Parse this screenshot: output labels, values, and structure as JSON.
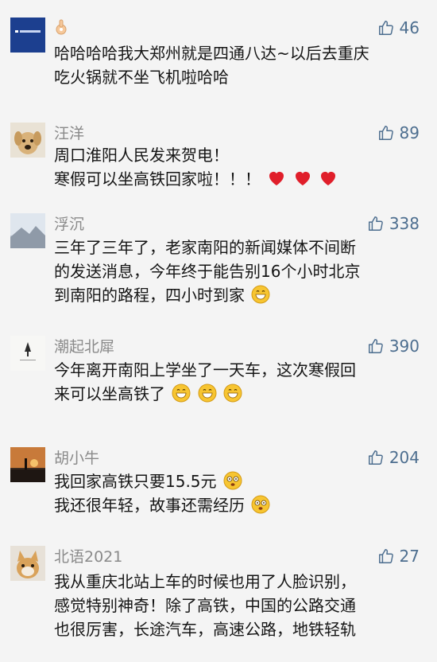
{
  "comments": [
    {
      "name": "",
      "avatar": "blue-logo-avatar",
      "name_icon": "ok-hand-icon",
      "likes": "46",
      "lines": [
        "哈哈哈哈我大郑州就是四通八达~以后去重庆",
        "吃火锅就不坐飞机啦哈哈"
      ]
    },
    {
      "name": "汪洋",
      "avatar": "dog-avatar",
      "likes": "89",
      "lines": [
        "周口淮阳人民发来贺电！",
        "寒假可以坐高铁回家啦！！！"
      ],
      "line_emojis": [
        [],
        [
          "red-heart-icon",
          "red-heart-icon",
          "red-heart-icon"
        ]
      ]
    },
    {
      "name": "浮沉",
      "avatar": "landscape-avatar",
      "likes": "338",
      "lines": [
        "三年了三年了，老家南阳的新闻媒体不间断",
        "的发送消息，今年终于能告别16个小时北京",
        "到南阳的路程，四小时到家"
      ],
      "line_emojis": [
        [],
        [],
        [
          "grin-emoji-icon"
        ]
      ]
    },
    {
      "name": "潮起北犀",
      "avatar": "ink-painting-avatar",
      "likes": "390",
      "lines": [
        "今年离开南阳上学坐了一天车，这次寒假回",
        "来可以坐高铁了"
      ],
      "line_emojis": [
        [],
        [
          "grin-emoji-icon",
          "grin-emoji-icon",
          "grin-emoji-icon"
        ]
      ]
    },
    {
      "name": "胡小牛",
      "avatar": "sunset-silhouette-avatar",
      "likes": "204",
      "lines": [
        "我回家高铁只要15.5元",
        "我还很年轻，故事还需经历"
      ],
      "line_emojis": [
        [
          "dizzy-face-icon"
        ],
        [
          "dizzy-face-icon"
        ]
      ]
    },
    {
      "name": "北语2021",
      "avatar": "cat-avatar",
      "likes": "27",
      "lines": [
        "我从重庆北站上车的时候也用了人脸识别，",
        "感觉特别神奇！除了高铁，中国的公路交通",
        "也很厉害，长途汽车，高速公路，地铁轻轨"
      ]
    }
  ],
  "colors": {
    "background": "#f4f4f4",
    "like_text": "#4d6e8f",
    "name_text": "#8a8a8a",
    "body_text": "#151515"
  }
}
